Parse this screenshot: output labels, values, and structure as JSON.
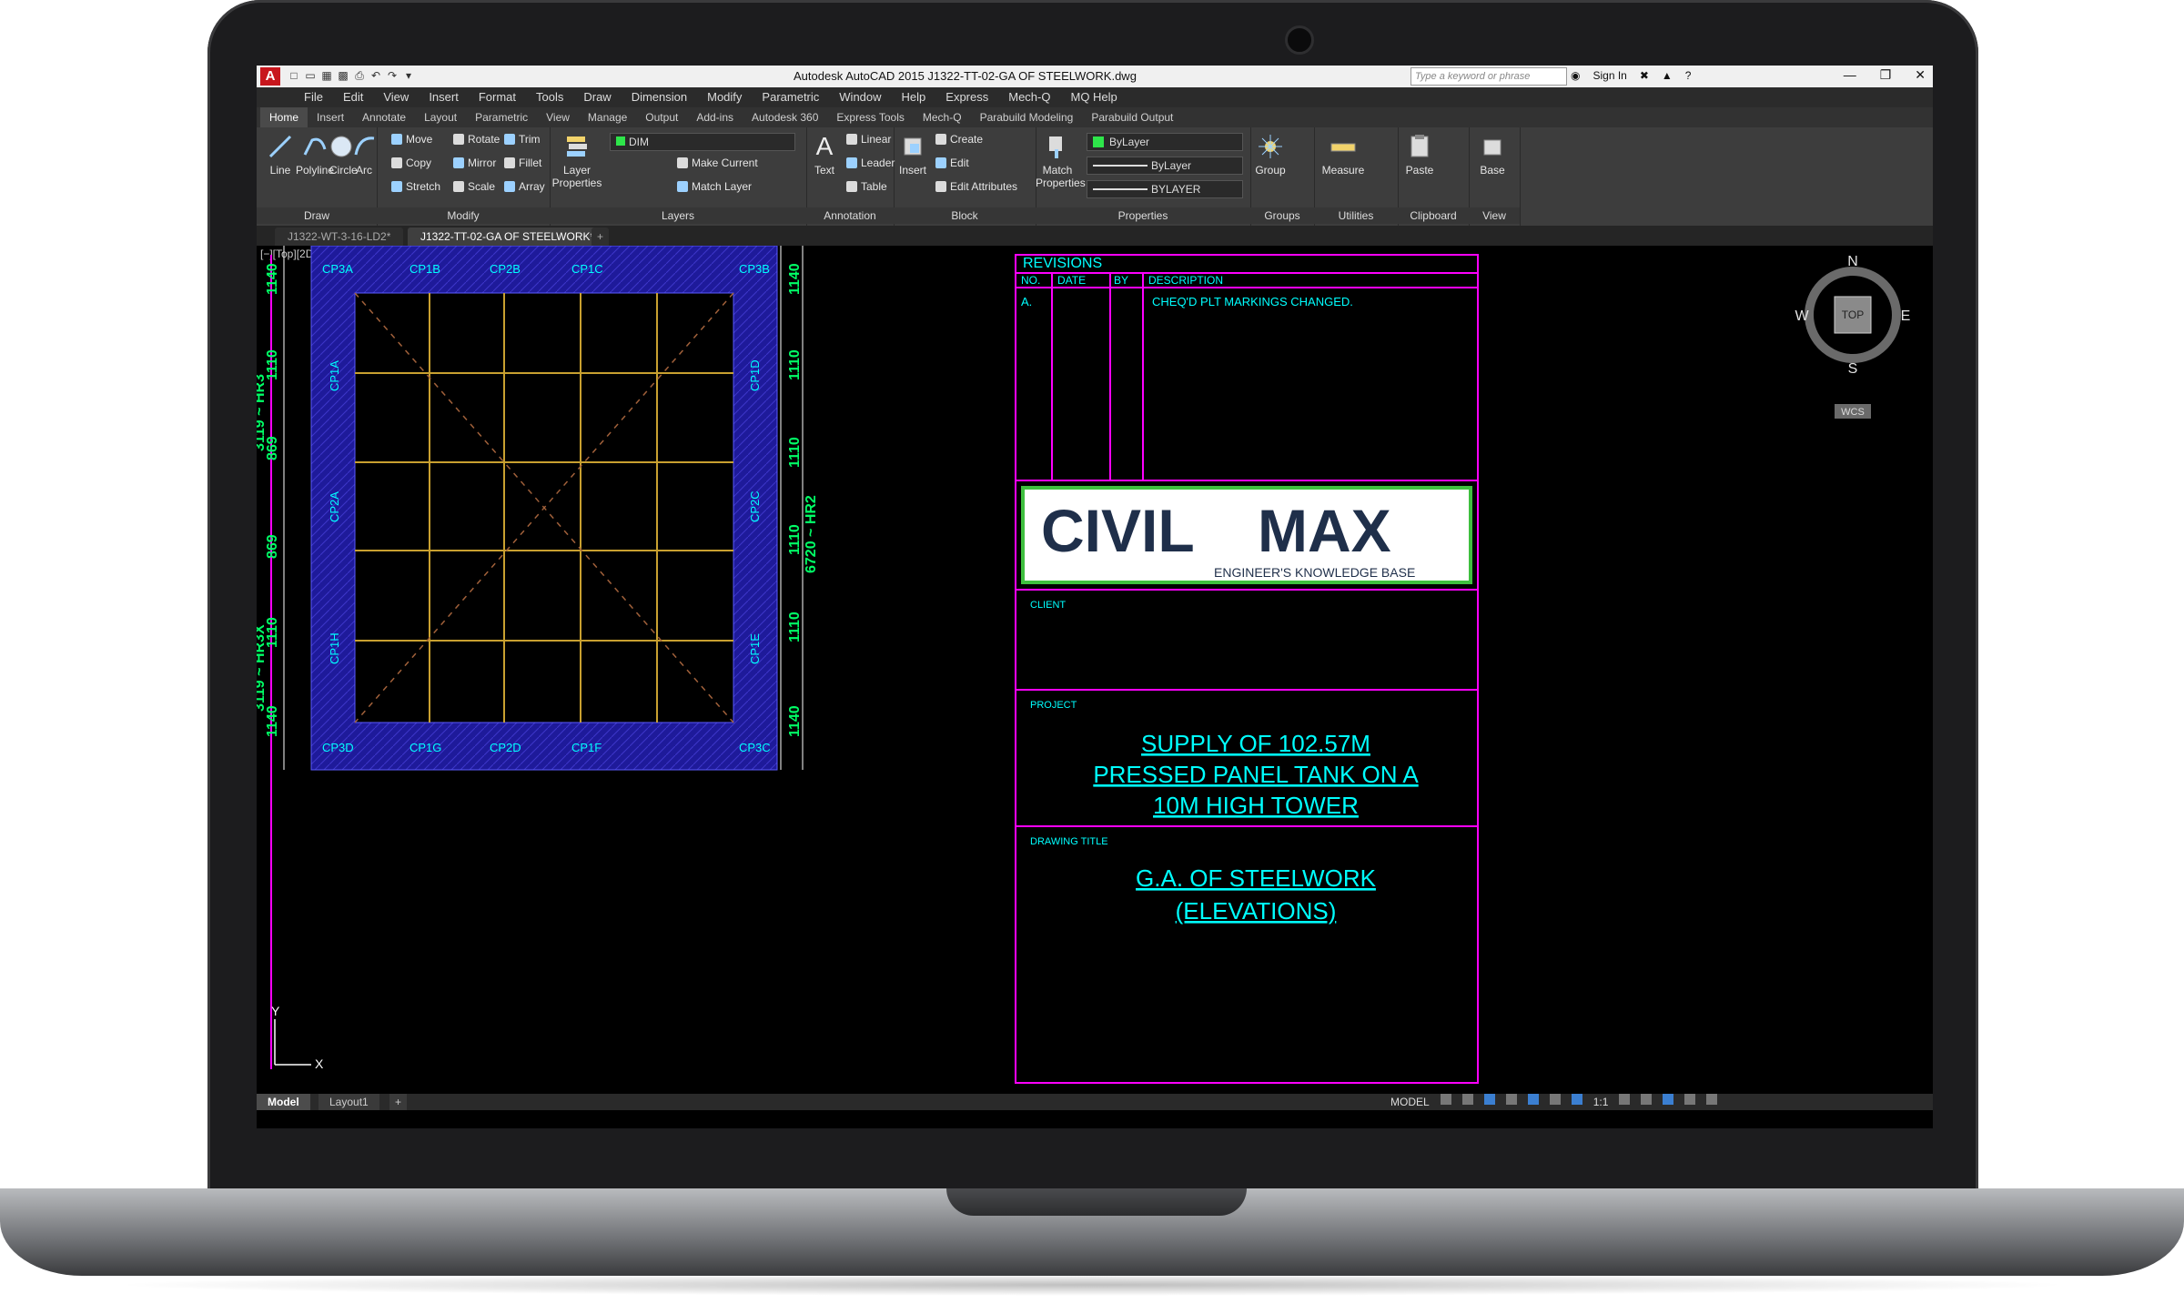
{
  "window": {
    "app_icon": "A",
    "title": "Autodesk AutoCAD 2015   J1322-TT-02-GA OF STEELWORK.dwg",
    "search_placeholder": "Type a keyword or phrase",
    "sign_in": "Sign In"
  },
  "menu": [
    "File",
    "Edit",
    "View",
    "Insert",
    "Format",
    "Tools",
    "Draw",
    "Dimension",
    "Modify",
    "Parametric",
    "Window",
    "Help",
    "Express",
    "Mech-Q",
    "MQ Help"
  ],
  "ribbon_tabs": [
    "Home",
    "Insert",
    "Annotate",
    "Layout",
    "Parametric",
    "View",
    "Manage",
    "Output",
    "Add-ins",
    "Autodesk 360",
    "Express Tools",
    "Mech-Q",
    "Parabuild Modeling",
    "Parabuild Output"
  ],
  "ribbon": {
    "draw": {
      "title": "Draw",
      "line": "Line",
      "polyline": "Polyline",
      "circle": "Circle",
      "arc": "Arc"
    },
    "modify": {
      "title": "Modify",
      "move": "Move",
      "rotate": "Rotate",
      "trim": "Trim",
      "copy": "Copy",
      "mirror": "Mirror",
      "fillet": "Fillet",
      "stretch": "Stretch",
      "scale": "Scale",
      "array": "Array"
    },
    "layers": {
      "title": "Layers",
      "layer_properties_1": "Layer",
      "layer_properties_2": "Properties",
      "current_layer": "DIM",
      "make_current": "Make Current",
      "match_layer": "Match Layer"
    },
    "annotation": {
      "title": "Annotation",
      "text": "Text",
      "linear": "Linear",
      "leader": "Leader",
      "table": "Table"
    },
    "block": {
      "title": "Block",
      "insert": "Insert",
      "create": "Create",
      "edit": "Edit",
      "edit_attributes": "Edit Attributes"
    },
    "properties": {
      "title": "Properties",
      "match_1": "Match",
      "match_2": "Properties",
      "color": "ByLayer",
      "linetype": "ByLayer",
      "lineweight": "BYLAYER"
    },
    "groups": {
      "title": "Groups",
      "group": "Group"
    },
    "utilities": {
      "title": "Utilities",
      "measure": "Measure"
    },
    "clipboard": {
      "title": "Clipboard",
      "paste": "Paste"
    },
    "view": {
      "title": "View",
      "base": "Base"
    }
  },
  "doc_tabs": [
    "J1322-WT-3-16-LD2*",
    "J1322-TT-02-GA OF STEELWORK*"
  ],
  "viewport_label": "[−][Top][2D Wireframe]",
  "viewcube": {
    "n": "N",
    "s": "S",
    "e": "E",
    "w": "W",
    "top": "TOP",
    "wcs": "WCS"
  },
  "drawing": {
    "left_dims": [
      "1140",
      "1110",
      "869",
      "869",
      "1110",
      "1140"
    ],
    "right_dims": [
      "1140",
      "1110",
      "1110",
      "1110",
      "1110",
      "1140"
    ],
    "left_overall_top": "3119 ~ HR3",
    "left_overall_bottom": "3119 ~ HR3X",
    "right_overall": "6720 ~ HR2",
    "top_labels": [
      "CP3A",
      "CP1B",
      "CP2B",
      "CP1C",
      "CP3B"
    ],
    "bottom_labels": [
      "CP3D",
      "CP1G",
      "CP2D",
      "CP1F",
      "CP3C"
    ],
    "left_labels": [
      "CP1A",
      "CP2A",
      "CP1H"
    ],
    "right_labels": [
      "CP1D",
      "CP2C",
      "CP1E"
    ],
    "ucs_x": "X",
    "ucs_y": "Y"
  },
  "titleblock": {
    "revisions": "REVISIONS",
    "headers": {
      "no": "NO.",
      "date": "DATE",
      "by": "BY",
      "description": "DESCRIPTION"
    },
    "rev_no": "A.",
    "rev_desc": "CHEQ'D PLT MARKINGS CHANGED.",
    "logo_1": "CIVIL",
    "logo_2": "MAX",
    "logo_tagline": "ENGINEER'S KNOWLEDGE BASE",
    "client_label": "CLIENT",
    "project_label": "PROJECT",
    "project_lines": [
      "SUPPLY OF 102.57M",
      "PRESSED PANEL TANK ON A",
      "10M HIGH TOWER"
    ],
    "drawing_title_label": "DRAWING TITLE",
    "drawing_title_lines": [
      "G.A. OF STEELWORK",
      "(ELEVATIONS)"
    ]
  },
  "layout_tabs": [
    "Model",
    "Layout1"
  ],
  "status": {
    "model": "MODEL",
    "scale": "1:1"
  }
}
